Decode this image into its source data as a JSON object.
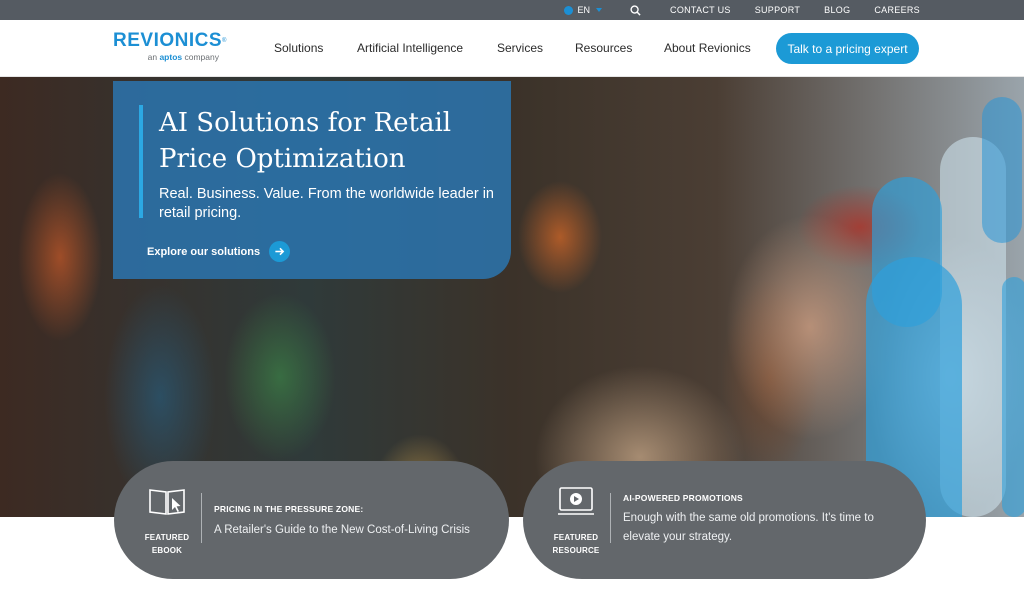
{
  "utility_bar": {
    "language": "EN",
    "links": [
      "CONTACT US",
      "SUPPORT",
      "BLOG",
      "CAREERS"
    ]
  },
  "nav": {
    "logo": "Revionics",
    "logo_sub_prefix": "an",
    "logo_sub_brand": "aptos",
    "logo_sub_suffix": "company",
    "items": [
      "Solutions",
      "Artificial Intelligence",
      "Services",
      "Resources",
      "About Revionics"
    ],
    "cta": "Talk to a pricing expert"
  },
  "hero": {
    "title": "AI Solutions for Retail Price Optimization",
    "subtitle": "Real. Business. Value. From the worldwide leader in retail pricing.",
    "link": "Explore our solutions"
  },
  "features": [
    {
      "tag_line1": "FEATURED",
      "tag_line2": "EBOOK",
      "eyebrow": "PRICING IN THE PRESSURE ZONE:",
      "text": "A Retailer's Guide to the New Cost-of-Living Crisis",
      "icon": "open-book-icon"
    },
    {
      "tag_line1": "FEATURED",
      "tag_line2": "RESOURCE",
      "eyebrow": "AI-POWERED PROMOTIONS",
      "text": "Enough with the same old promotions. It's time to elevate your strategy.",
      "icon": "video-monitor-icon"
    }
  ],
  "colors": {
    "brand_blue": "#1c9ad6",
    "utility_bar": "#555b62",
    "feature_card": "#63676b"
  }
}
